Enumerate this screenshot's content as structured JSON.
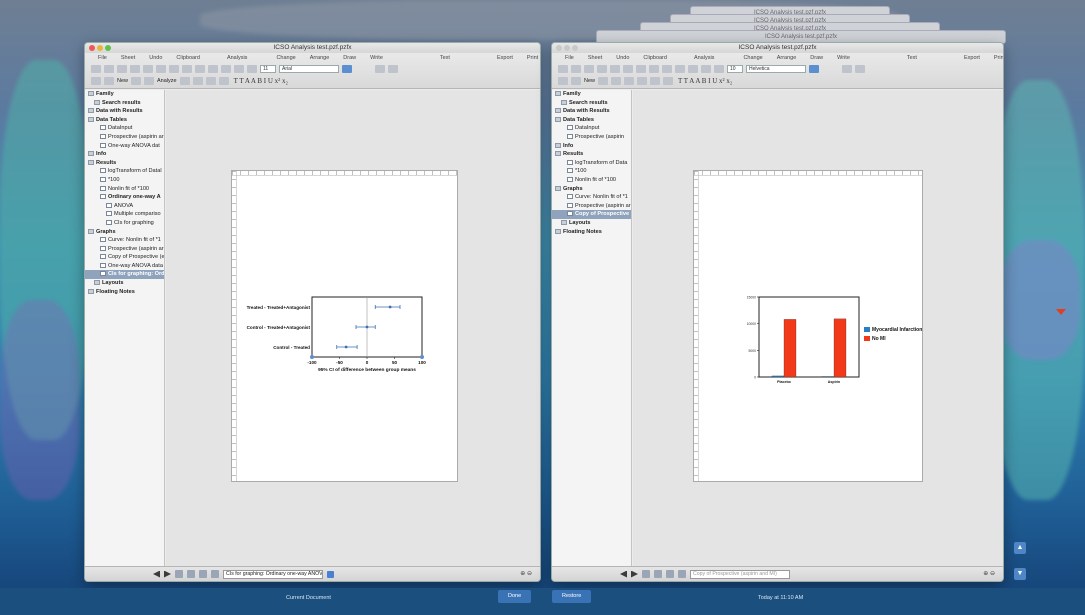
{
  "ghost_titles": [
    "ICSO Analysis test.pzf.pzfx",
    "ICSO Analysis test.pzf.pzfx",
    "ICSO Analysis test.pzf.pzfx",
    "ICSO Analysis test.pzf.pzfx"
  ],
  "toolbar": {
    "labels_left": [
      "File",
      "Sheet",
      "Undo",
      "Clipboard",
      "Analysis",
      "Change",
      "Arrange",
      "Draw",
      "Write",
      "Text",
      "Export",
      "Print"
    ],
    "new_label": "New",
    "analyze_label": "Analyze",
    "font_size_left": "11",
    "font_name_left": "Arial",
    "font_size_right": "10",
    "font_name_right": "Helvetica",
    "text_buttons": "T  T A A B I U x² x₂"
  },
  "window_left": {
    "title": "ICSO Analysis test.pzf.pzfx",
    "sidebar": [
      {
        "label": "Family",
        "type": "folder",
        "level": 0,
        "sec": true
      },
      {
        "label": "Search results",
        "type": "folder",
        "level": 1,
        "sec": true
      },
      {
        "label": "Data with Results",
        "type": "folder",
        "level": 0,
        "sec": true
      },
      {
        "label": "Data Tables",
        "type": "folder",
        "level": 0,
        "sec": true
      },
      {
        "label": "DataInput",
        "type": "sheet",
        "level": 2
      },
      {
        "label": "Prospective (aspirin ar",
        "type": "sheet",
        "level": 2
      },
      {
        "label": "One-way ANOVA dat",
        "type": "sheet",
        "level": 2
      },
      {
        "label": "Info",
        "type": "folder",
        "level": 0,
        "sec": true
      },
      {
        "label": "Results",
        "type": "folder",
        "level": 0,
        "sec": true
      },
      {
        "label": "logTransform of Datal",
        "type": "sheet",
        "level": 2
      },
      {
        "label": "*100",
        "type": "sheet",
        "level": 2
      },
      {
        "label": "Nonlin fit of *100",
        "type": "sheet",
        "level": 2
      },
      {
        "label": "Ordinary one-way A",
        "type": "sheet",
        "level": 2,
        "sec": true
      },
      {
        "label": "ANOVA",
        "type": "sheet",
        "level": 3
      },
      {
        "label": "Multiple compariso",
        "type": "sheet",
        "level": 3
      },
      {
        "label": "CIs for graphing",
        "type": "sheet",
        "level": 3
      },
      {
        "label": "Graphs",
        "type": "folder",
        "level": 0,
        "sec": true
      },
      {
        "label": "Curve: Nonlin fit of *1",
        "type": "sheet",
        "level": 2
      },
      {
        "label": "Prospective (aspirin ar",
        "type": "sheet",
        "level": 2
      },
      {
        "label": "Copy of Prospective (e",
        "type": "sheet",
        "level": 2
      },
      {
        "label": "One-way ANOVA data",
        "type": "sheet",
        "level": 2
      },
      {
        "label": "CIs for graphing: Ord",
        "type": "sheet",
        "level": 2,
        "sel": true
      },
      {
        "label": "Layouts",
        "type": "folder",
        "level": 1,
        "sec": true
      },
      {
        "label": "Floating Notes",
        "type": "folder",
        "level": 0,
        "sec": true
      }
    ],
    "bottom_field": "CIs for graphing: Ordinary one-way ANOVA",
    "zoom": "⊕ ⊖"
  },
  "window_right": {
    "title": "ICSO Analysis test.pzf.pzfx",
    "sidebar": [
      {
        "label": "Family",
        "type": "folder",
        "level": 0,
        "sec": true
      },
      {
        "label": "Search results",
        "type": "folder",
        "level": 1,
        "sec": true
      },
      {
        "label": "Data with Results",
        "type": "folder",
        "level": 0,
        "sec": true
      },
      {
        "label": "Data Tables",
        "type": "folder",
        "level": 0,
        "sec": true
      },
      {
        "label": "DataInput",
        "type": "sheet",
        "level": 2
      },
      {
        "label": "Prospective (aspirin",
        "type": "sheet",
        "level": 2
      },
      {
        "label": "Info",
        "type": "folder",
        "level": 0,
        "sec": true
      },
      {
        "label": "Results",
        "type": "folder",
        "level": 0,
        "sec": true
      },
      {
        "label": "logTransform of Data",
        "type": "sheet",
        "level": 2
      },
      {
        "label": "*100",
        "type": "sheet",
        "level": 2
      },
      {
        "label": "Nonlin fit of *100",
        "type": "sheet",
        "level": 2
      },
      {
        "label": "Graphs",
        "type": "folder",
        "level": 0,
        "sec": true
      },
      {
        "label": "Curve: Nonlin fit of *1",
        "type": "sheet",
        "level": 2
      },
      {
        "label": "Prospective (aspirin ar",
        "type": "sheet",
        "level": 2
      },
      {
        "label": "Copy of Prospective",
        "type": "sheet",
        "level": 2,
        "sel": true
      },
      {
        "label": "Layouts",
        "type": "folder",
        "level": 1,
        "sec": true
      },
      {
        "label": "Floating Notes",
        "type": "folder",
        "level": 0,
        "sec": true
      }
    ],
    "bottom_field": "Copy of Prospective (aspirin and MI)",
    "zoom": "⊕ ⊖"
  },
  "footer": {
    "current_document": "Current Document",
    "done": "Done",
    "restore": "Restore",
    "time": "Today at 11:10 AM"
  },
  "chart_data": [
    {
      "type": "scatter",
      "subtype": "confidence-interval",
      "categories": [
        "Treated - Treated+Antagonist",
        "Control - Treated+Antagonist",
        "Control - Treated"
      ],
      "points": [
        42,
        0,
        -38
      ],
      "lower": [
        15,
        -20,
        -55
      ],
      "upper": [
        60,
        15,
        -18
      ],
      "xlabel": "95% CI of difference between group means",
      "xlim": [
        -100,
        100
      ],
      "xticks": [
        -100,
        -50,
        0,
        50,
        100
      ],
      "color": "#3a6fb0"
    },
    {
      "type": "bar",
      "categories": [
        "Placebo",
        "Aspirin"
      ],
      "series": [
        {
          "name": "Myocardial Infarction",
          "values": [
            200,
            100
          ],
          "color": "#2a7fc4"
        },
        {
          "name": "No MI",
          "values": [
            10800,
            10900
          ],
          "color": "#f23a1a"
        }
      ],
      "ylim": [
        0,
        15000
      ],
      "yticks": [
        0,
        5000,
        10000,
        15000
      ],
      "legend": "right"
    }
  ]
}
